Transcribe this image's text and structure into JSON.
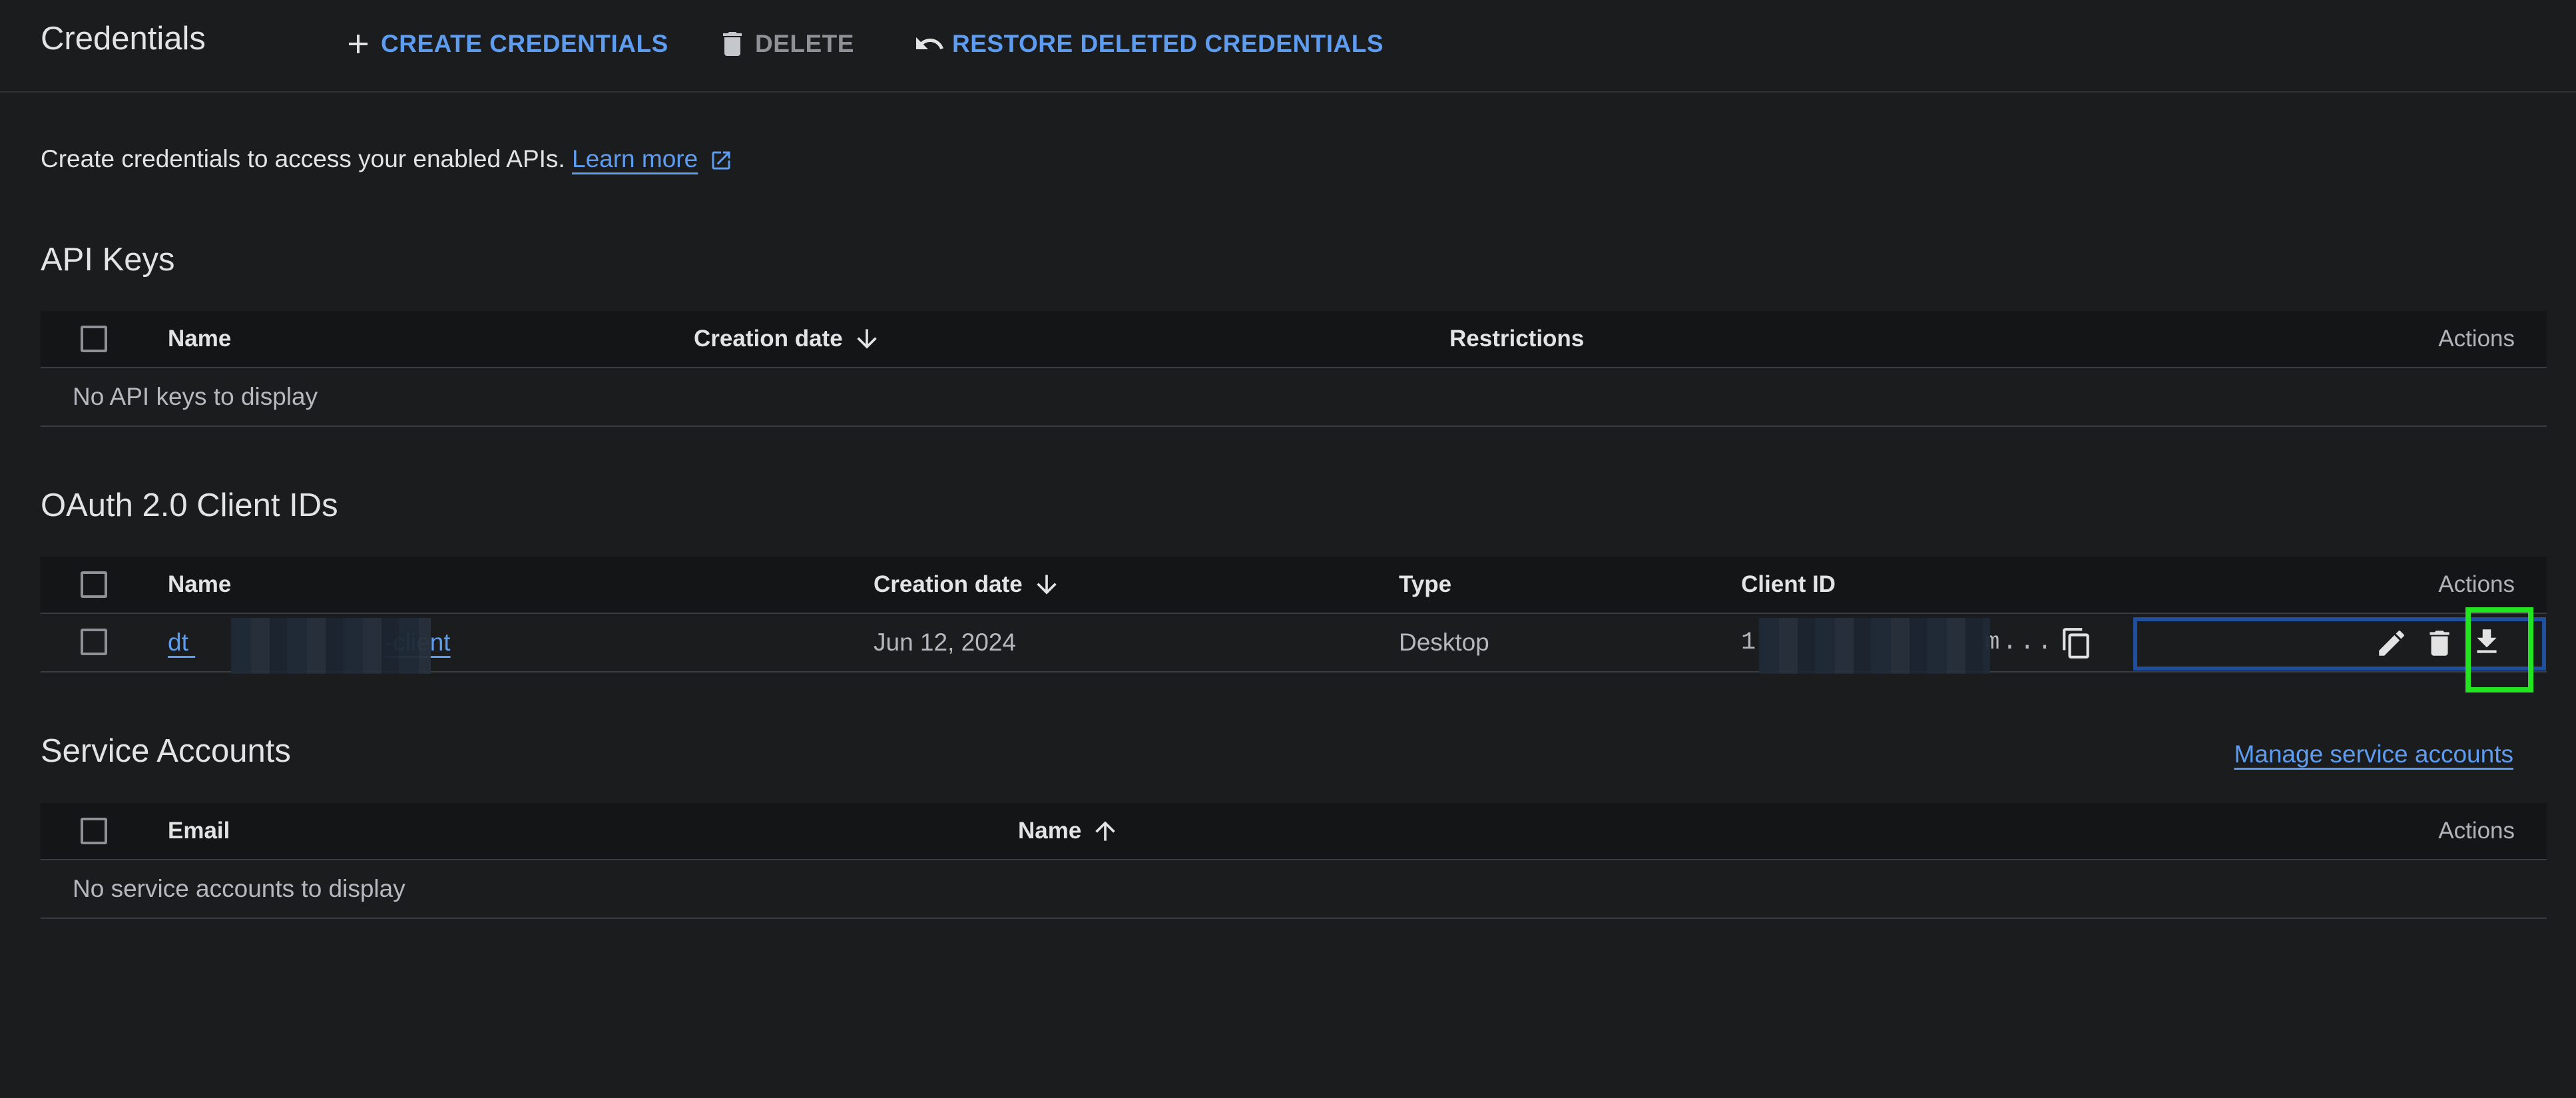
{
  "header": {
    "title": "Credentials",
    "create_label": "CREATE CREDENTIALS",
    "delete_label": "DELETE",
    "restore_label": "RESTORE DELETED CREDENTIALS"
  },
  "intro": {
    "text": "Create credentials to access your enabled APIs.",
    "learn_more": "Learn more"
  },
  "api_keys": {
    "title": "API Keys",
    "columns": {
      "name": "Name",
      "creation_date": "Creation date",
      "restrictions": "Restrictions",
      "actions": "Actions"
    },
    "empty_text": "No API keys to display"
  },
  "oauth": {
    "title": "OAuth 2.0 Client IDs",
    "columns": {
      "name": "Name",
      "creation_date": "Creation date",
      "type": "Type",
      "client_id": "Client ID",
      "actions": "Actions"
    },
    "rows": [
      {
        "name_prefix": "dt",
        "name_suffix": "-client",
        "creation_date": "Jun 12, 2024",
        "type": "Desktop",
        "client_id_prefix": "1",
        "client_id_suffix": "m..."
      }
    ]
  },
  "service_accounts": {
    "title": "Service Accounts",
    "manage_link": "Manage service accounts",
    "columns": {
      "email": "Email",
      "name": "Name",
      "actions": "Actions"
    },
    "empty_text": "No service accounts to display"
  },
  "colors": {
    "background": "#1b1c1e",
    "accent": "#5e9cf0",
    "header_row": "#141517",
    "highlight": "#23e51f",
    "focus": "#1f4f9d"
  },
  "icons": [
    "plus-icon",
    "trash-icon",
    "undo-icon",
    "external-link-icon",
    "arrow-down-icon",
    "arrow-up-icon",
    "copy-icon",
    "edit-icon",
    "download-icon"
  ]
}
